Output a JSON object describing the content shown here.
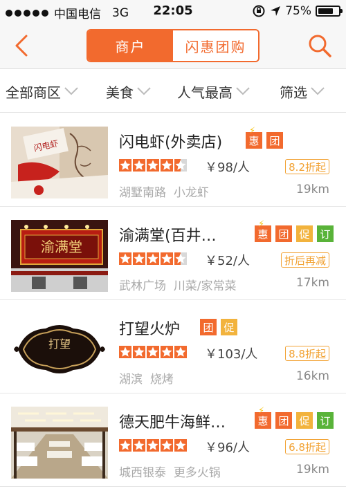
{
  "status_bar": {
    "carrier": "中国电信",
    "network": "3G",
    "time": "22:05",
    "battery_text": "75%",
    "battery_level": 0.75,
    "icons": [
      "rotation-lock-icon",
      "location-arrow-icon",
      "battery-icon"
    ]
  },
  "nav": {
    "back_icon": "chevron-left-icon",
    "tabs": [
      {
        "label": "商户",
        "active": true
      },
      {
        "label": "闪惠团购",
        "active": false
      }
    ],
    "search_icon": "search-icon",
    "accent_color": "#f26a2e"
  },
  "filters": [
    {
      "label": "全部商区"
    },
    {
      "label": "美食"
    },
    {
      "label": "人气最高"
    },
    {
      "label": "筛选"
    }
  ],
  "merchants": [
    {
      "name": "闪电虾(外卖店)",
      "tags": [
        {
          "text": "惠",
          "color": "orange",
          "bolt": true
        },
        {
          "text": "团",
          "color": "orange",
          "bolt": false
        }
      ],
      "rating": 4.5,
      "price": "￥98/人",
      "discount": "8.2折起",
      "area": "湖墅南路",
      "category": "小龙虾",
      "distance": "19km"
    },
    {
      "name": "渝满堂(百井…",
      "tags": [
        {
          "text": "惠",
          "color": "orange",
          "bolt": true
        },
        {
          "text": "团",
          "color": "orange",
          "bolt": false
        },
        {
          "text": "促",
          "color": "yellow",
          "bolt": false
        },
        {
          "text": "订",
          "color": "green",
          "bolt": false
        }
      ],
      "rating": 4.5,
      "price": "￥52/人",
      "discount": "折后再减",
      "area": "武林广场",
      "category": "川菜/家常菜",
      "distance": "17km"
    },
    {
      "name": "打望火炉",
      "tags": [
        {
          "text": "团",
          "color": "orange",
          "bolt": false
        },
        {
          "text": "促",
          "color": "yellow",
          "bolt": false
        }
      ],
      "rating": 5,
      "price": "￥103/人",
      "discount": "8.8折起",
      "area": "湖滨",
      "category": "烧烤",
      "distance": "16km"
    },
    {
      "name": "德天肥牛海鲜…",
      "tags": [
        {
          "text": "惠",
          "color": "orange",
          "bolt": true
        },
        {
          "text": "团",
          "color": "orange",
          "bolt": false
        },
        {
          "text": "促",
          "color": "yellow",
          "bolt": false
        },
        {
          "text": "订",
          "color": "green",
          "bolt": false
        }
      ],
      "rating": 5,
      "price": "￥96/人",
      "discount": "6.8折起",
      "area": "城西银泰",
      "category": "更多火锅",
      "distance": "19km"
    }
  ],
  "thumbnails": {
    "shop1_sign": "闪电虾",
    "shop2_sign": "渝满堂",
    "shop3_logo": "打望"
  }
}
